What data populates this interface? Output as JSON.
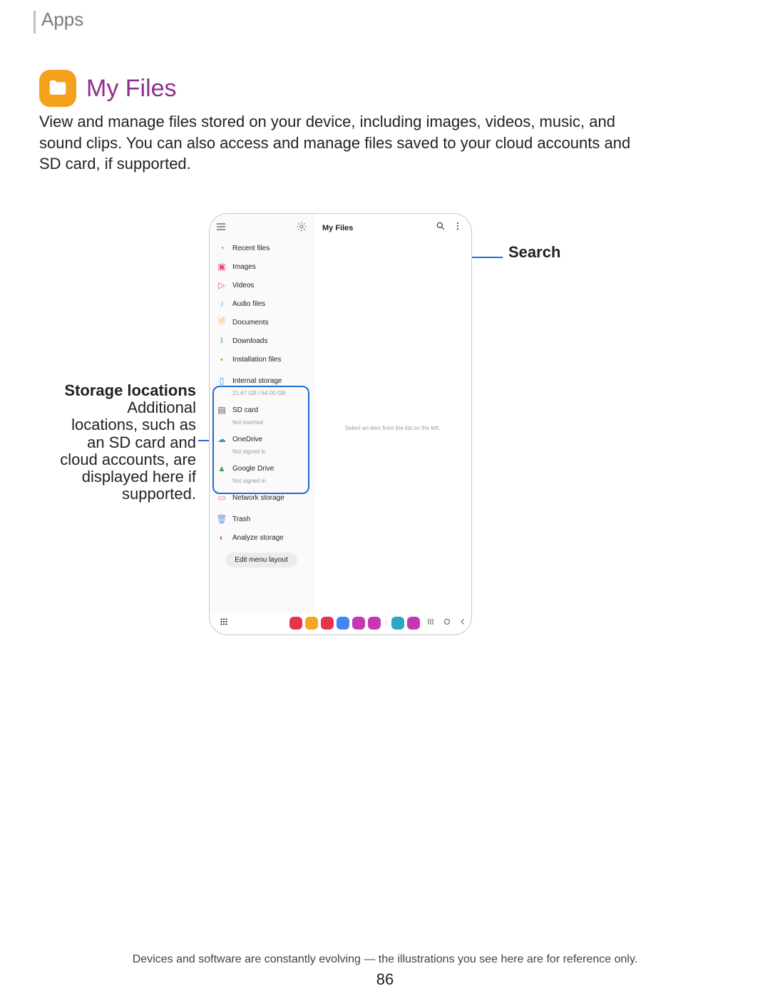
{
  "breadcrumb": "Apps",
  "section_title": "My Files",
  "intro": "View and manage files stored on your device, including images, videos, music, and sound clips. You can also access and manage files saved to your cloud accounts and SD card, if supported.",
  "device": {
    "content_title": "My Files",
    "content_hint": "Select an item from the list on the left.",
    "sidebar": {
      "cat_items": [
        {
          "label": "Recent files",
          "color": "#9a9a9a",
          "glyph": "◔"
        },
        {
          "label": "Images",
          "color": "#e24b6b",
          "glyph": "▣"
        },
        {
          "label": "Videos",
          "color": "#e24b6b",
          "glyph": "▷"
        },
        {
          "label": "Audio files",
          "color": "#6fb5e8",
          "glyph": "♪"
        },
        {
          "label": "Documents",
          "color": "#f3a23d",
          "glyph": "🗎"
        },
        {
          "label": "Downloads",
          "color": "#5dbf6a",
          "glyph": "⭳"
        },
        {
          "label": "Installation files",
          "color": "#9ec144",
          "glyph": "▪"
        }
      ],
      "storage_items": [
        {
          "label": "Internal storage",
          "sub": "21.67 GB / 64.00 GB",
          "color": "#4f8ee0",
          "glyph": "▯"
        },
        {
          "label": "SD card",
          "sub": "Not inserted",
          "color": "#555",
          "glyph": "▤"
        },
        {
          "label": "OneDrive",
          "sub": "Not signed in",
          "color": "#3a94d6",
          "glyph": "☁"
        },
        {
          "label": "Google Drive",
          "sub": "Not signed in",
          "color": "#3aa757",
          "glyph": "▲"
        },
        {
          "label": "Network storage",
          "sub": "",
          "color": "#e76f87",
          "glyph": "▭"
        }
      ],
      "util_items": [
        {
          "label": "Trash",
          "color": "#6a9ade",
          "glyph": "🗑"
        },
        {
          "label": "Analyze storage",
          "color": "#e07b4f",
          "glyph": "◐"
        }
      ],
      "edit_layout": "Edit menu layout"
    },
    "navbar_colors": [
      "#e6344d",
      "#f5a623",
      "#e6344d",
      "#4285f4",
      "#c33ab0",
      "#c33ab0",
      "#2aa8c4",
      "#c33ab0"
    ]
  },
  "callouts": {
    "search": "Search",
    "storage_title": "Storage locations",
    "storage_body": "Additional locations, such as an SD card and cloud accounts, are displayed here if supported."
  },
  "footer_note": "Devices and software are constantly evolving — the illustrations you see here are for reference only.",
  "page_number": "86"
}
